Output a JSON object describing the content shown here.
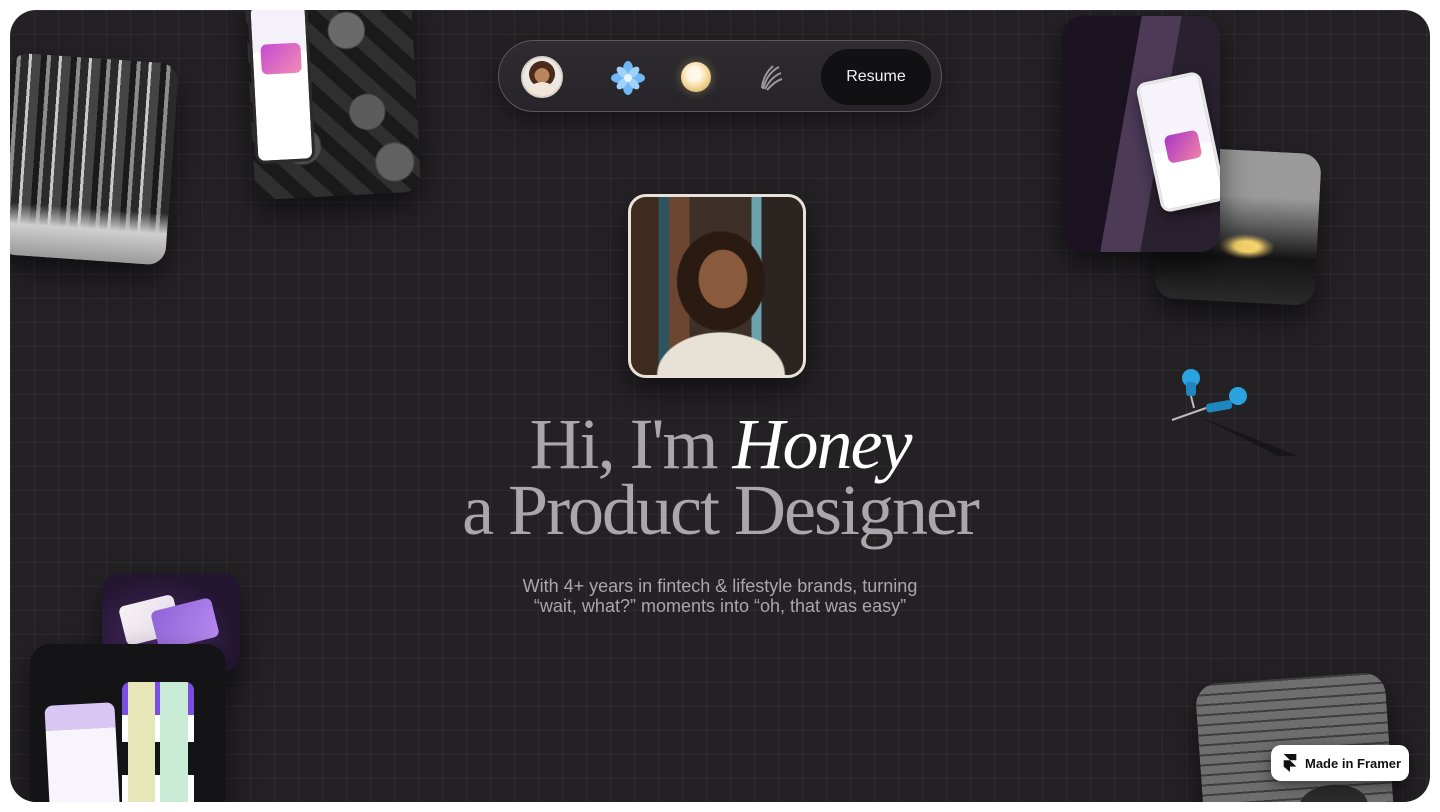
{
  "nav": {
    "icons": [
      "avatar",
      "flower-icon",
      "orb-icon",
      "leaf-icon"
    ],
    "resume_label": "Resume"
  },
  "hero": {
    "greeting": "Hi, I'm ",
    "name": "Honey",
    "role": "a Product Designer",
    "tagline_line1": "With 4+ years in fintech & lifestyle brands, turning",
    "tagline_line2": "“wait, what?” moments into “oh, that was easy”"
  },
  "badge": {
    "label": "Made in Framer"
  },
  "colors": {
    "background": "#232124",
    "headline_muted": "#a9a7ab",
    "headline_accent": "#ffffff",
    "pin_blue": "#2aa3e0"
  }
}
